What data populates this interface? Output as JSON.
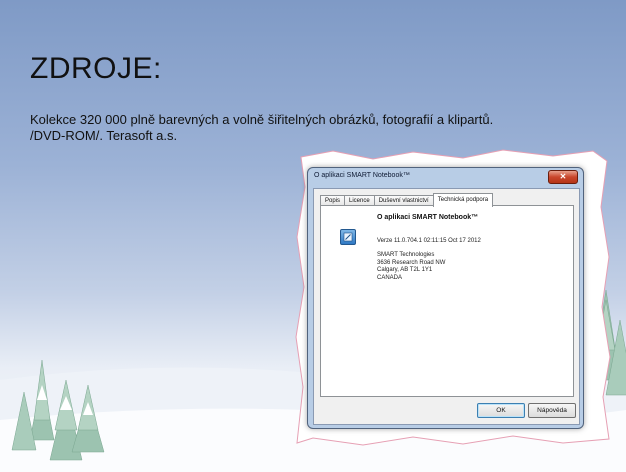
{
  "slide": {
    "title": "ZDROJE:",
    "body_line1": "Kolekce 320 000 plně barevných a volně šiřitelných obrázků, fotografií a klipartů.",
    "body_line2": "/DVD-ROM/. Terasoft a.s."
  },
  "dialog": {
    "title": "O aplikaci SMART Notebook™",
    "tabs": [
      "Popis",
      "Licence",
      "Duševní vlastnictví",
      "Technická podpora"
    ],
    "active_tab": "Technická podpora",
    "heading": "O aplikaci SMART Notebook™",
    "version": "Verze 11.0.704.1 02:11:15 Oct 17 2012",
    "address": [
      "SMART Technologies",
      "3636 Research Road NW",
      "Calgary, AB T2L 1Y1",
      "CANADA"
    ],
    "buttons": {
      "ok": "OK",
      "help": "Nápověda"
    },
    "icon": "smart-notebook-icon"
  },
  "colors": {
    "sky_top": "#7f9ac6",
    "snow": "#f7f9fc",
    "tree": "#8fb8a4",
    "close_button": "#c9462c"
  }
}
